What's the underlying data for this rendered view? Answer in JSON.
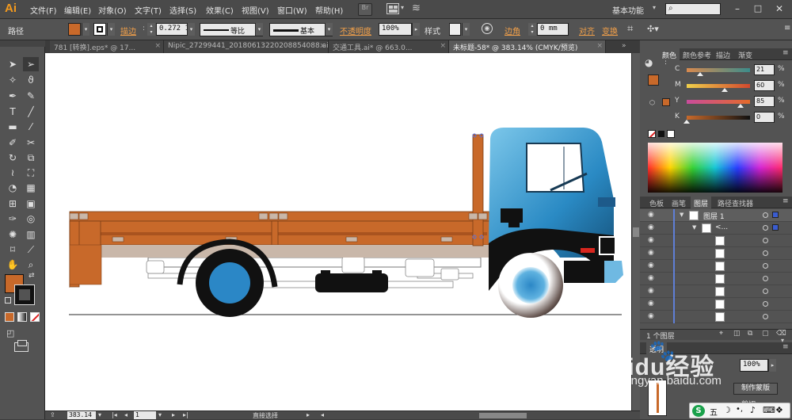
{
  "app": {
    "logo": "Ai",
    "menus": [
      "文件(F)",
      "编辑(E)",
      "对象(O)",
      "文字(T)",
      "选择(S)",
      "效果(C)",
      "视图(V)",
      "窗口(W)",
      "帮助(H)"
    ],
    "workspace": "基本功能",
    "br_label": "Br"
  },
  "control_bar": {
    "selection_type": "路径",
    "stroke_label": "描边",
    "stroke_weight": "0.272 1",
    "profile_label": "等比",
    "brush_label": "基本",
    "opacity_label": "不透明度",
    "opacity_value": "100%",
    "style_label": "样式",
    "corner_label": "边角",
    "corner_value": "0 mm",
    "align_label": "对齐",
    "transform_label": "变换",
    "fill_color": "#c8692a"
  },
  "tabs": [
    {
      "label": "781 [转换].eps* @ 17...",
      "active": false
    },
    {
      "label": "Nipic_27299441_20180613220208854088.ai* @ ...",
      "active": false
    },
    {
      "label": "交通工具.ai* @ 663.0...",
      "active": false
    },
    {
      "label": "未标题-58* @ 383.14% (CMYK/预览)",
      "active": true
    }
  ],
  "tools": [
    "selection-arrow",
    "direct-selection",
    "magic-wand",
    "lasso",
    "pen",
    "curvature",
    "type",
    "line",
    "rectangle",
    "brush",
    "pencil",
    "shaper",
    "rotate",
    "scale",
    "width",
    "free-transform",
    "shape-builder",
    "perspective-grid",
    "mesh",
    "gradient",
    "eyedropper",
    "blend",
    "symbol-sprayer",
    "column-graph",
    "artboard",
    "slice",
    "hand",
    "zoom"
  ],
  "status": {
    "zoom": "383.14",
    "page": "1",
    "tool": "直接选择"
  },
  "color_panel": {
    "tabs": [
      "颜色",
      "颜色参考",
      "描边",
      "渐变"
    ],
    "channels": [
      {
        "name": "C",
        "value": "21",
        "fraction": 0.21
      },
      {
        "name": "M",
        "value": "60",
        "fraction": 0.6
      },
      {
        "name": "Y",
        "value": "85",
        "fraction": 0.85
      },
      {
        "name": "K",
        "value": "0",
        "fraction": 0.0
      }
    ],
    "percent_sign": "%",
    "swatch_color": "#c8692a"
  },
  "layers_panel": {
    "tabs": [
      "色板",
      "画笔",
      "图层",
      "路径查找器"
    ],
    "layer_name": "图层 1",
    "sublayer_name": "<...",
    "count_label": "1 个图层",
    "row_count": 8
  },
  "transparency_panel": {
    "tab": "透明",
    "opacity": "100%",
    "mask_button": "制作蒙版",
    "clip_label": "剪切"
  },
  "watermark": {
    "brand": "Baidu经验",
    "url": "jingyan.baidu.com"
  },
  "ime": {
    "label": "五"
  }
}
